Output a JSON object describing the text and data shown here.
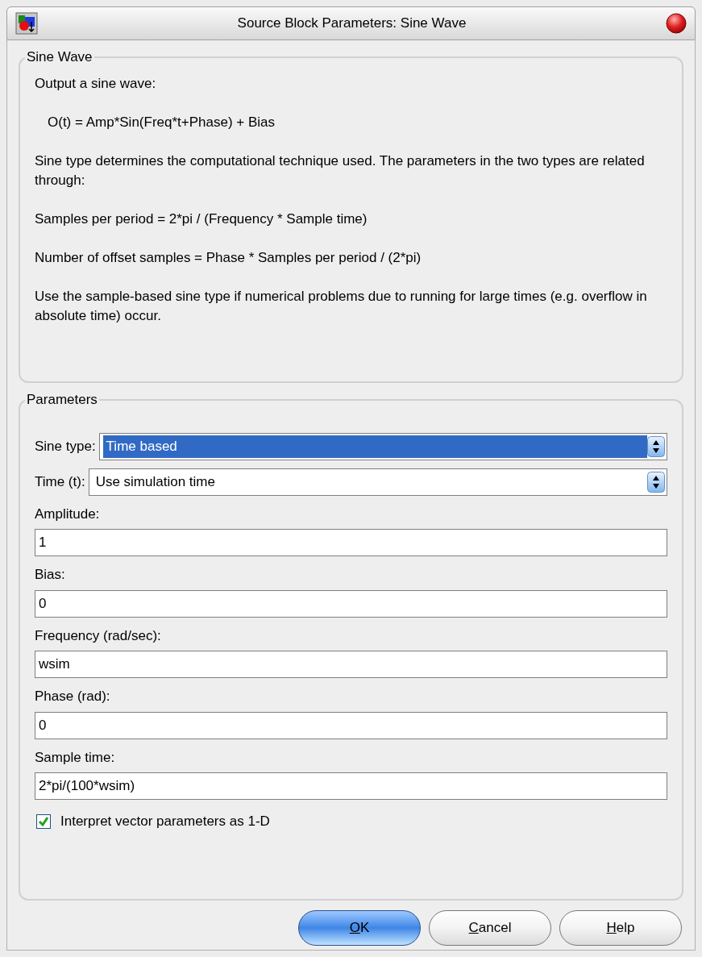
{
  "window": {
    "title": "Source Block Parameters: Sine Wave"
  },
  "description": {
    "title": "Sine Wave",
    "paragraphs": [
      {
        "kind": "text",
        "text": "Output a sine wave:"
      },
      {
        "kind": "formula",
        "text": "O(t) = Amp*Sin(Freq*t+Phase) + Bias"
      },
      {
        "kind": "text",
        "text": "Sine type determines the computational technique used. The parameters in the two types are related through:"
      },
      {
        "kind": "text",
        "text": "Samples per period = 2*pi / (Frequency * Sample time)"
      },
      {
        "kind": "text",
        "text": "Number of offset samples = Phase * Samples per period / (2*pi)"
      },
      {
        "kind": "text",
        "text": "Use the sample-based sine type if numerical problems due to running for large times (e.g. overflow in absolute time) occur."
      }
    ]
  },
  "parameters": {
    "title": "Parameters",
    "fields": [
      {
        "kind": "dropdown",
        "label": "Sine type:",
        "value": "Time based",
        "focused": true
      },
      {
        "kind": "dropdown",
        "label": "Time (t):",
        "value": "Use simulation time",
        "focused": false
      },
      {
        "kind": "text",
        "label": "Amplitude:",
        "value": "1"
      },
      {
        "kind": "text",
        "label": "Bias:",
        "value": "0"
      },
      {
        "kind": "text",
        "label": "Frequency (rad/sec):",
        "value": "wsim"
      },
      {
        "kind": "text",
        "label": "Phase (rad):",
        "value": "0"
      },
      {
        "kind": "text",
        "label": "Sample time:",
        "value": "2*pi/(100*wsim)"
      },
      {
        "kind": "checkbox",
        "label": "Interpret vector parameters as 1-D",
        "checked": true
      }
    ]
  },
  "buttons": [
    {
      "accelerator": "O",
      "rest": "K",
      "default": true
    },
    {
      "accelerator": "C",
      "rest": "ancel",
      "default": false
    },
    {
      "accelerator": "H",
      "rest": "elp",
      "default": false
    }
  ]
}
